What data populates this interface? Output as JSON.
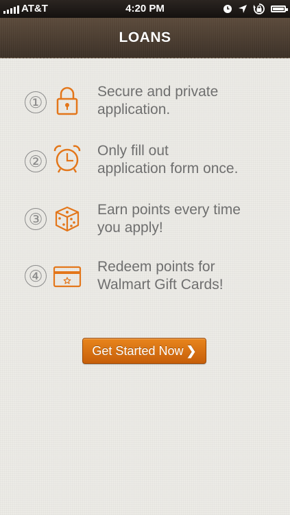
{
  "status_bar": {
    "carrier": "AT&T",
    "time": "4:20 PM",
    "icons": [
      "signal-icon",
      "clock-icon",
      "location-arrow-icon",
      "rotation-lock-icon",
      "battery-icon"
    ]
  },
  "nav": {
    "title": "LOANS"
  },
  "steps": [
    {
      "number": "①",
      "icon": "padlock-icon",
      "line1": "Secure and private",
      "line2": "application."
    },
    {
      "number": "②",
      "icon": "alarm-clock-icon",
      "line1": "Only fill out",
      "line2": "application form once."
    },
    {
      "number": "③",
      "icon": "dice-icon",
      "line1": "Earn points every time",
      "line2": "you apply!"
    },
    {
      "number": "④",
      "icon": "gift-card-icon",
      "line1": "Redeem points for",
      "line2": "Walmart Gift Cards!"
    }
  ],
  "cta": {
    "label": "Get Started Now",
    "chevron": "❯"
  },
  "colors": {
    "accent": "#e3761a",
    "nav_bar": "#4a3c30",
    "text": "#6f6f6f",
    "background": "#ecebe6"
  }
}
